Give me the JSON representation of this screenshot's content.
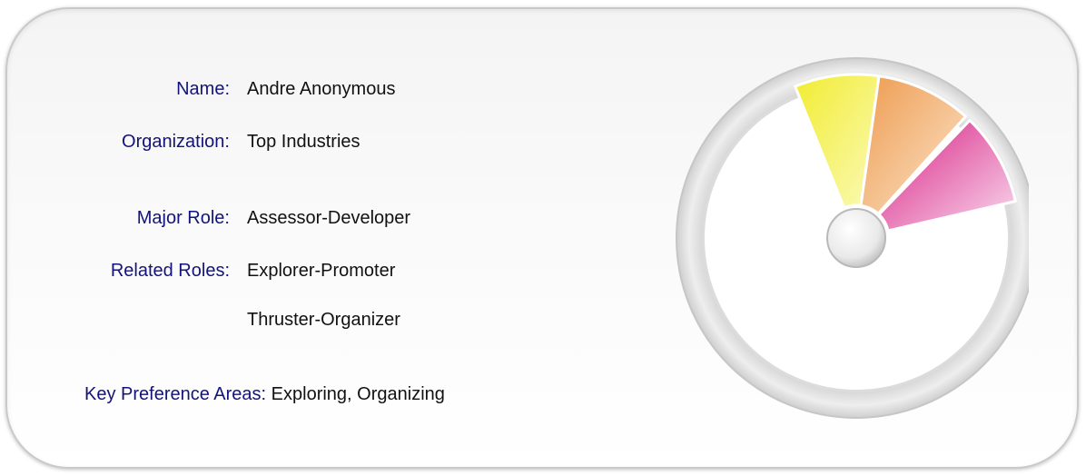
{
  "profile": {
    "name_label": "Name:",
    "name_value": "Andre Anonymous",
    "org_label": "Organization:",
    "org_value": "Top Industries",
    "major_role_label": "Major Role:",
    "major_role_value": "Assessor-Developer",
    "related_roles_label": "Related Roles:",
    "related_roles": [
      "Explorer-Promoter",
      "Thruster-Organizer"
    ],
    "key_pref_label": "Key Preference Areas:",
    "key_pref_value": "Exploring, Organizing"
  },
  "wheel": {
    "segments": [
      {
        "color": "#f2ee3c",
        "highlight": "#fbfab0"
      },
      {
        "color": "#f0a55c",
        "highlight": "#fbe3c6"
      },
      {
        "color": "#dc2a8a",
        "highlight": "#f8d6ec"
      }
    ],
    "ring_color": "#e6e6e6",
    "hub_color": "#f2f2f2"
  }
}
